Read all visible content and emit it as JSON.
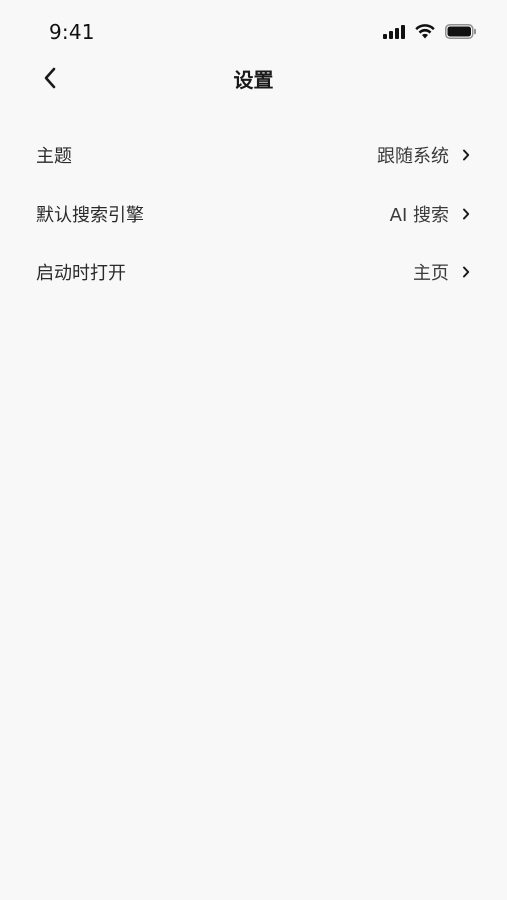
{
  "status_bar": {
    "time": "9:41",
    "icons": [
      "cellular-signal-icon",
      "wifi-icon",
      "battery-icon"
    ]
  },
  "nav": {
    "title": "设置",
    "back_icon": "chevron-left-icon"
  },
  "settings": {
    "items": [
      {
        "label": "主题",
        "value": "跟随系统"
      },
      {
        "label": "默认搜索引擎",
        "value": "AI 搜索"
      },
      {
        "label": "启动时打开",
        "value": "主页"
      }
    ]
  },
  "colors": {
    "background": "#f8f8f8",
    "text_primary": "#1a1a1a",
    "text_secondary": "#3a3a3a"
  }
}
